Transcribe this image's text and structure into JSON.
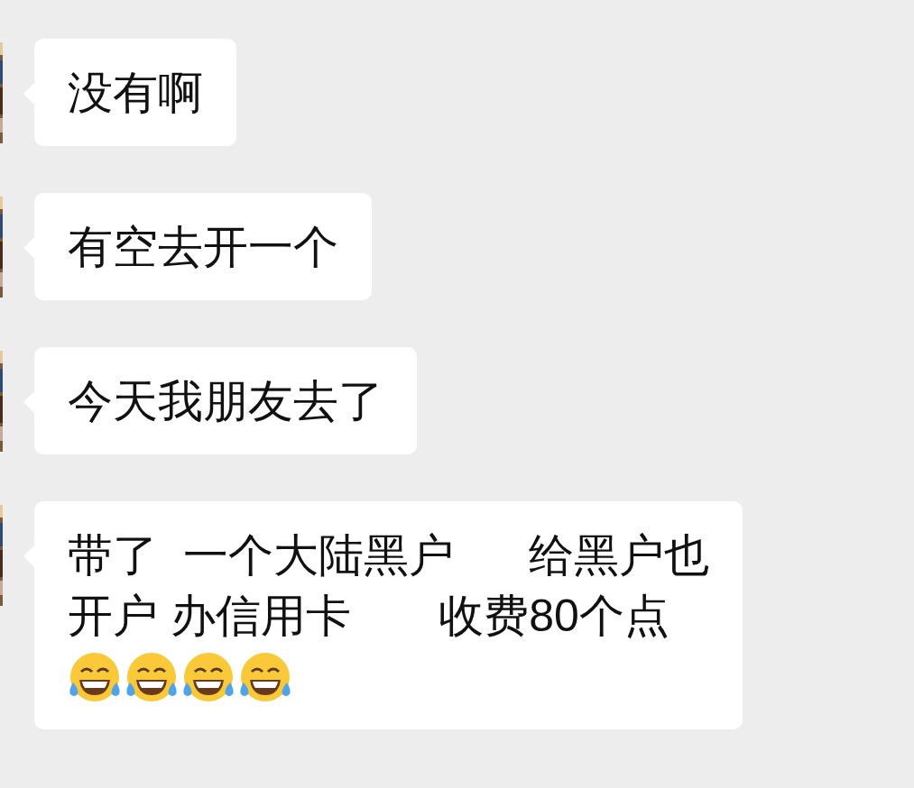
{
  "messages": [
    {
      "lines": [
        "没有啊"
      ]
    },
    {
      "lines": [
        "有空去开一个"
      ]
    },
    {
      "lines": [
        "今天我朋友去了"
      ]
    },
    {
      "lines": [
        "带了  一个大陆黑户      给黑户也",
        "开户 办信用卡       收费80个点"
      ],
      "emojis": [
        {
          "kind": "tears-of-joy"
        },
        {
          "kind": "tears-of-joy"
        },
        {
          "kind": "tears-of-joy"
        },
        {
          "kind": "tears-of-joy"
        }
      ]
    }
  ]
}
